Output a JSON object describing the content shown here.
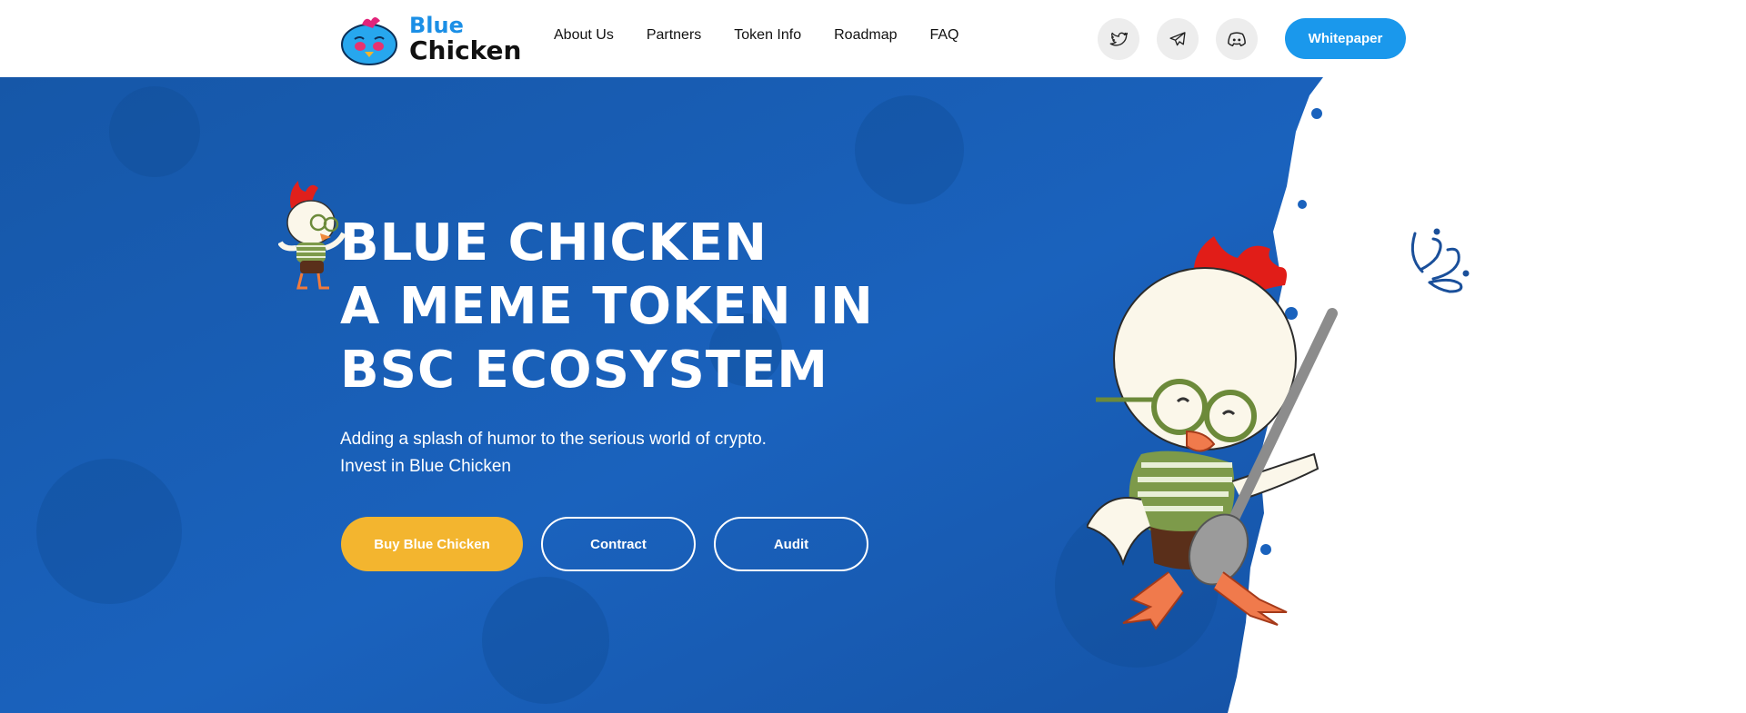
{
  "brand": {
    "line1": "Blue",
    "line2": "Chicken"
  },
  "nav": [
    "About Us",
    "Partners",
    "Token Info",
    "Roadmap",
    "FAQ"
  ],
  "social": [
    {
      "name": "twitter-icon"
    },
    {
      "name": "telegram-icon"
    },
    {
      "name": "discord-icon"
    }
  ],
  "whitepaper_label": "Whitepaper",
  "hero": {
    "headline": [
      "BLUE CHICKEN",
      "A MEME TOKEN IN",
      "BSC ECOSYSTEM"
    ],
    "subtitle": [
      "Adding a splash of humor to the serious world of crypto.",
      "Invest in Blue Chicken"
    ],
    "buttons": {
      "buy": "Buy Blue Chicken",
      "contract": "Contract",
      "audit": "Audit"
    }
  },
  "colors": {
    "hero_blue": "#1a5fb4",
    "accent_yellow": "#f3b52f",
    "button_blue": "#1a98ec"
  }
}
